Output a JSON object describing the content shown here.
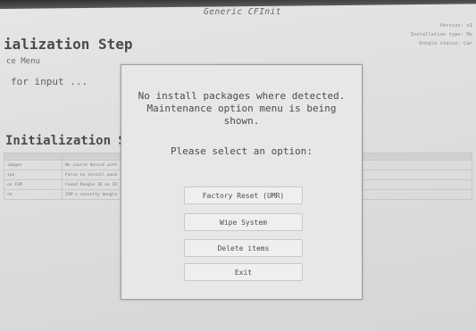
{
  "app_title": "Generic CFInit",
  "info": {
    "version": "Version: v1",
    "installation_type": "Installation type: Mo",
    "dongle_status": "Dongle status: Car"
  },
  "step_title": "ialization Step",
  "maintenance_menu": "ce Menu",
  "waiting_text": "for input ...",
  "section_title": "Initialization Step",
  "table": {
    "header": [
      "",
      "",
      "",
      ""
    ],
    "rows": [
      [
        "images",
        "No source device with",
        "",
        ""
      ],
      [
        "ion",
        "Force no install pack",
        "",
        ""
      ],
      [
        "os ISM",
        "Found Dongle ID on ID",
        "",
        ""
      ],
      [
        "ce",
        "ISM's security dongle",
        "",
        ""
      ]
    ]
  },
  "modal": {
    "message_line1": "No install packages where detected.",
    "message_line2": "Maintenance option menu is being",
    "message_line3": "shown.",
    "prompt": "Please select an option:",
    "options": [
      "Factory Reset (UMR)",
      "Wipe System",
      "Delete items",
      "Exit"
    ]
  }
}
